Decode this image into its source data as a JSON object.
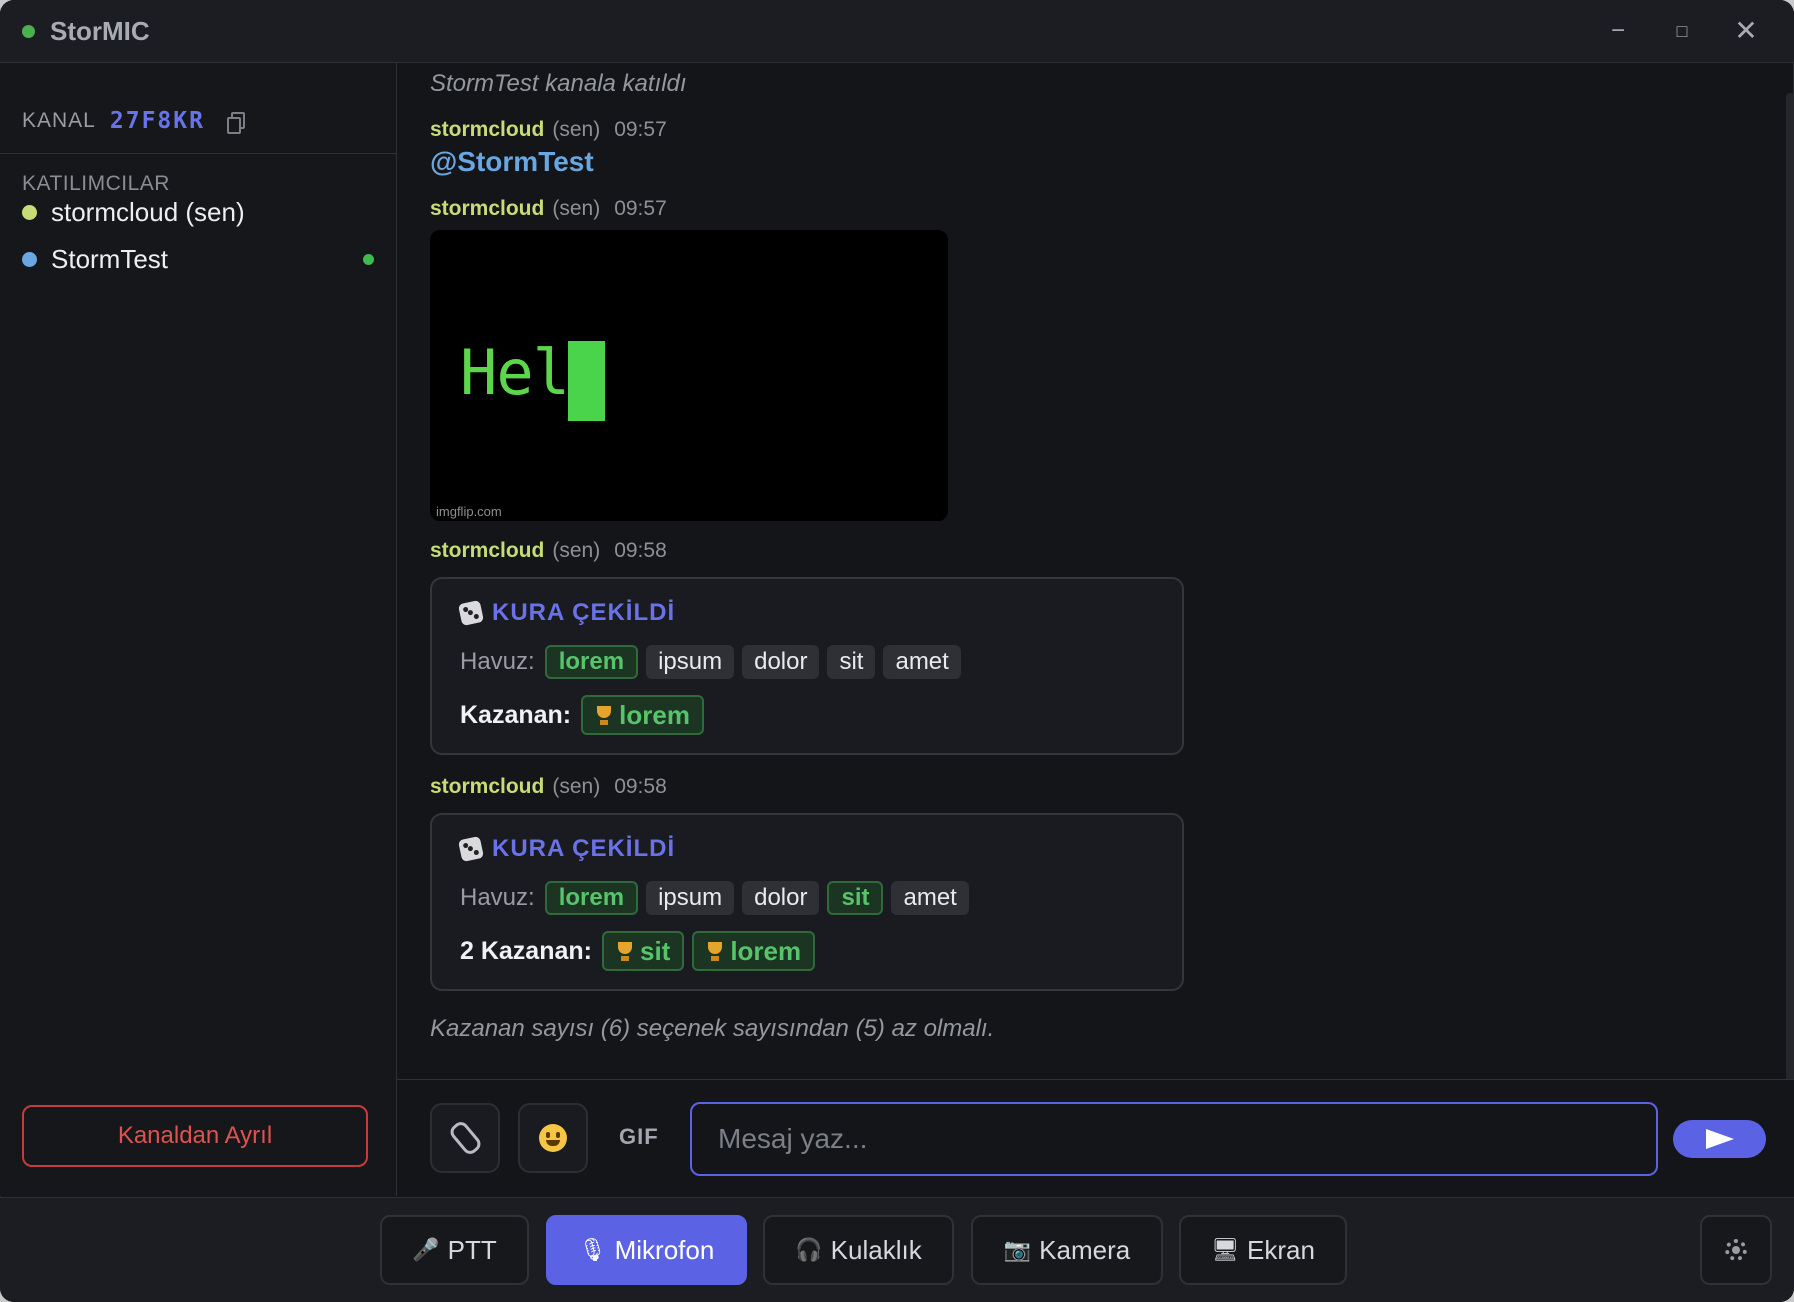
{
  "app": {
    "title": "StorMIC"
  },
  "window_controls": {
    "minimize": "−",
    "maximize": "□",
    "close": "✕"
  },
  "sidebar": {
    "channel_label": "KANAL",
    "channel_code": "27F8KR",
    "participants_title": "KATILIMCILAR",
    "participants": [
      {
        "name": "stormcloud (sen)",
        "color": "#c7dc77"
      },
      {
        "name": "StormTest",
        "color": "#6aa6e0",
        "online": true
      }
    ],
    "leave_label": "Kanaldan Ayrıl"
  },
  "messages": {
    "join_notice": "StormTest kanala katıldı",
    "msg1": {
      "author": "stormcloud",
      "you": "(sen)",
      "time": "09:57",
      "text": "@StormTest"
    },
    "msg2": {
      "author": "stormcloud",
      "you": "(sen)",
      "time": "09:57",
      "gif_text": "Hel",
      "gif_watermark": "imgflip.com"
    },
    "msg3": {
      "author": "stormcloud",
      "you": "(sen)",
      "time": "09:58",
      "title": "KURA ÇEKİLDİ",
      "pool_label": "Havuz:",
      "pool": [
        "lorem",
        "ipsum",
        "dolor",
        "sit",
        "amet"
      ],
      "winner_label": "Kazanan:",
      "winners": [
        "lorem"
      ]
    },
    "msg4": {
      "author": "stormcloud",
      "you": "(sen)",
      "time": "09:58",
      "title": "KURA ÇEKİLDİ",
      "pool_label": "Havuz:",
      "pool": [
        "lorem",
        "ipsum",
        "dolor",
        "sit",
        "amet"
      ],
      "winner_label": "2 Kazanan:",
      "winners": [
        "sit",
        "lorem"
      ]
    },
    "error_notice": "Kazanan sayısı (6) seçenek sayısından (5) az olmalı."
  },
  "composer": {
    "gif_label": "GIF",
    "placeholder": "Mesaj yaz...",
    "value": ""
  },
  "controls": {
    "ptt": "PTT",
    "mic": "Mikrofon",
    "headphones": "Kulaklık",
    "camera": "Kamera",
    "screen": "Ekran",
    "active": "mic"
  },
  "icons": {
    "attach": "paperclip-icon",
    "emoji": "smiley-icon",
    "send": "send-icon",
    "settings": "gear-icon",
    "copy": "copy-icon",
    "dice": "dice-icon",
    "trophy": "trophy-icon"
  },
  "colors": {
    "accent": "#5b62e3",
    "author": "#c7dc77",
    "mention": "#6aa6e0",
    "winner": "#57c36a",
    "danger": "#e0524f"
  }
}
